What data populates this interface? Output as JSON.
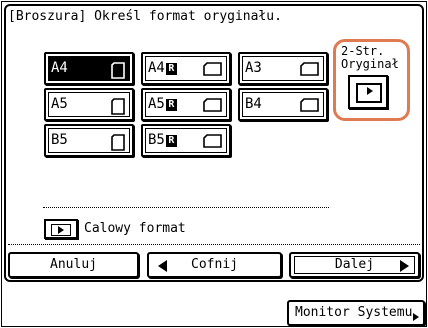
{
  "title": "[Broszura] Określ format oryginału.",
  "sizes": [
    {
      "label": "A4",
      "rotated": false,
      "orientation": "portrait",
      "selected": true
    },
    {
      "label": "A4",
      "rotated": true,
      "orientation": "landscape",
      "selected": false
    },
    {
      "label": "A3",
      "rotated": false,
      "orientation": "landscape",
      "selected": false
    },
    {
      "label": "A5",
      "rotated": false,
      "orientation": "portrait",
      "selected": false
    },
    {
      "label": "A5",
      "rotated": true,
      "orientation": "landscape",
      "selected": false
    },
    {
      "label": "B4",
      "rotated": false,
      "orientation": "landscape",
      "selected": false
    },
    {
      "label": "B5",
      "rotated": false,
      "orientation": "portrait",
      "selected": false
    },
    {
      "label": "B5",
      "rotated": true,
      "orientation": "landscape",
      "selected": false
    }
  ],
  "rotate_mark": "R",
  "two_sided": {
    "line1": "2-Str.",
    "line2": "Oryginał"
  },
  "inch_format": "Calowy format",
  "buttons": {
    "cancel": "Anuluj",
    "back": "Cofnij",
    "next": "Dalej",
    "monitor": "Monitor Systemu"
  },
  "colors": {
    "highlight": "#e07a52"
  }
}
